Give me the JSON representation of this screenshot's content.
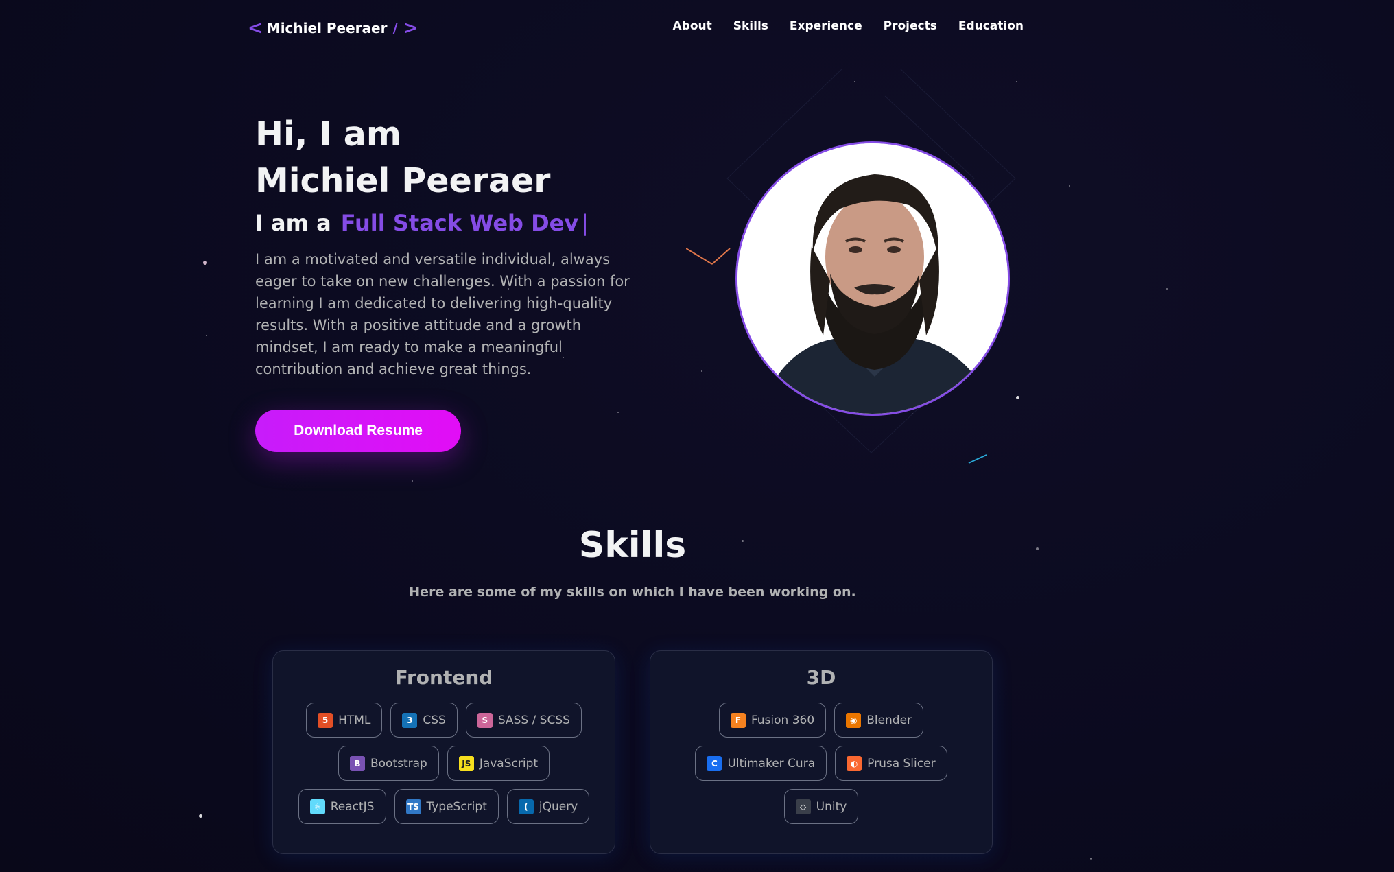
{
  "nav": {
    "logo_left": "<",
    "logo_name": "Michiel Peeraer",
    "logo_slash": "/",
    "logo_right": ">",
    "links": [
      "About",
      "Skills",
      "Experience",
      "Projects",
      "Education"
    ]
  },
  "hero": {
    "greeting": "Hi, I am",
    "name": "Michiel Peeraer",
    "role_prefix": "I am a",
    "role_typed": "Full Stack Web Dev",
    "role_cursor": "|",
    "description": "I am a motivated and versatile individual, always eager to take on new challenges. With a passion for learning I am dedicated to delivering high-quality results. With a positive attitude and a growth mindset, I am ready to make a meaningful contribution and achieve great things.",
    "resume_button": "Download Resume"
  },
  "skills": {
    "title": "Skills",
    "subtitle": "Here are some of my skills on which I have been working on.",
    "categories": [
      {
        "title": "Frontend",
        "rows": [
          [
            {
              "label": "HTML",
              "icon": "html5-icon",
              "color": "#e34f26",
              "glyph": "5"
            },
            {
              "label": "CSS",
              "icon": "css3-icon",
              "color": "#1572b6",
              "glyph": "3"
            },
            {
              "label": "SASS / SCSS",
              "icon": "sass-icon",
              "color": "#cc6699",
              "glyph": "S"
            }
          ],
          [
            {
              "label": "Bootstrap",
              "icon": "bootstrap-icon",
              "color": "#7952b3",
              "glyph": "B"
            },
            {
              "label": "JavaScript",
              "icon": "javascript-icon",
              "color": "#f7df1e",
              "glyph": "JS"
            }
          ],
          [
            {
              "label": "ReactJS",
              "icon": "react-icon",
              "color": "#61dafb",
              "glyph": "⚛"
            },
            {
              "label": "TypeScript",
              "icon": "typescript-icon",
              "color": "#3178c6",
              "glyph": "TS"
            },
            {
              "label": "jQuery",
              "icon": "jquery-icon",
              "color": "#0769ad",
              "glyph": "("
            }
          ]
        ]
      },
      {
        "title": "3D",
        "rows": [
          [
            {
              "label": "Fusion 360",
              "icon": "fusion360-icon",
              "color": "#f58220",
              "glyph": "F"
            },
            {
              "label": "Blender",
              "icon": "blender-icon",
              "color": "#ea7600",
              "glyph": "◉"
            }
          ],
          [
            {
              "label": "Ultimaker Cura",
              "icon": "ultimaker-cura-icon",
              "color": "#196ef0",
              "glyph": "C"
            },
            {
              "label": "Prusa Slicer",
              "icon": "prusa-slicer-icon",
              "color": "#fa6831",
              "glyph": "◐"
            }
          ],
          [
            {
              "label": "Unity",
              "icon": "unity-icon",
              "color": "#3a3f4a",
              "glyph": "◇"
            }
          ]
        ]
      }
    ]
  }
}
